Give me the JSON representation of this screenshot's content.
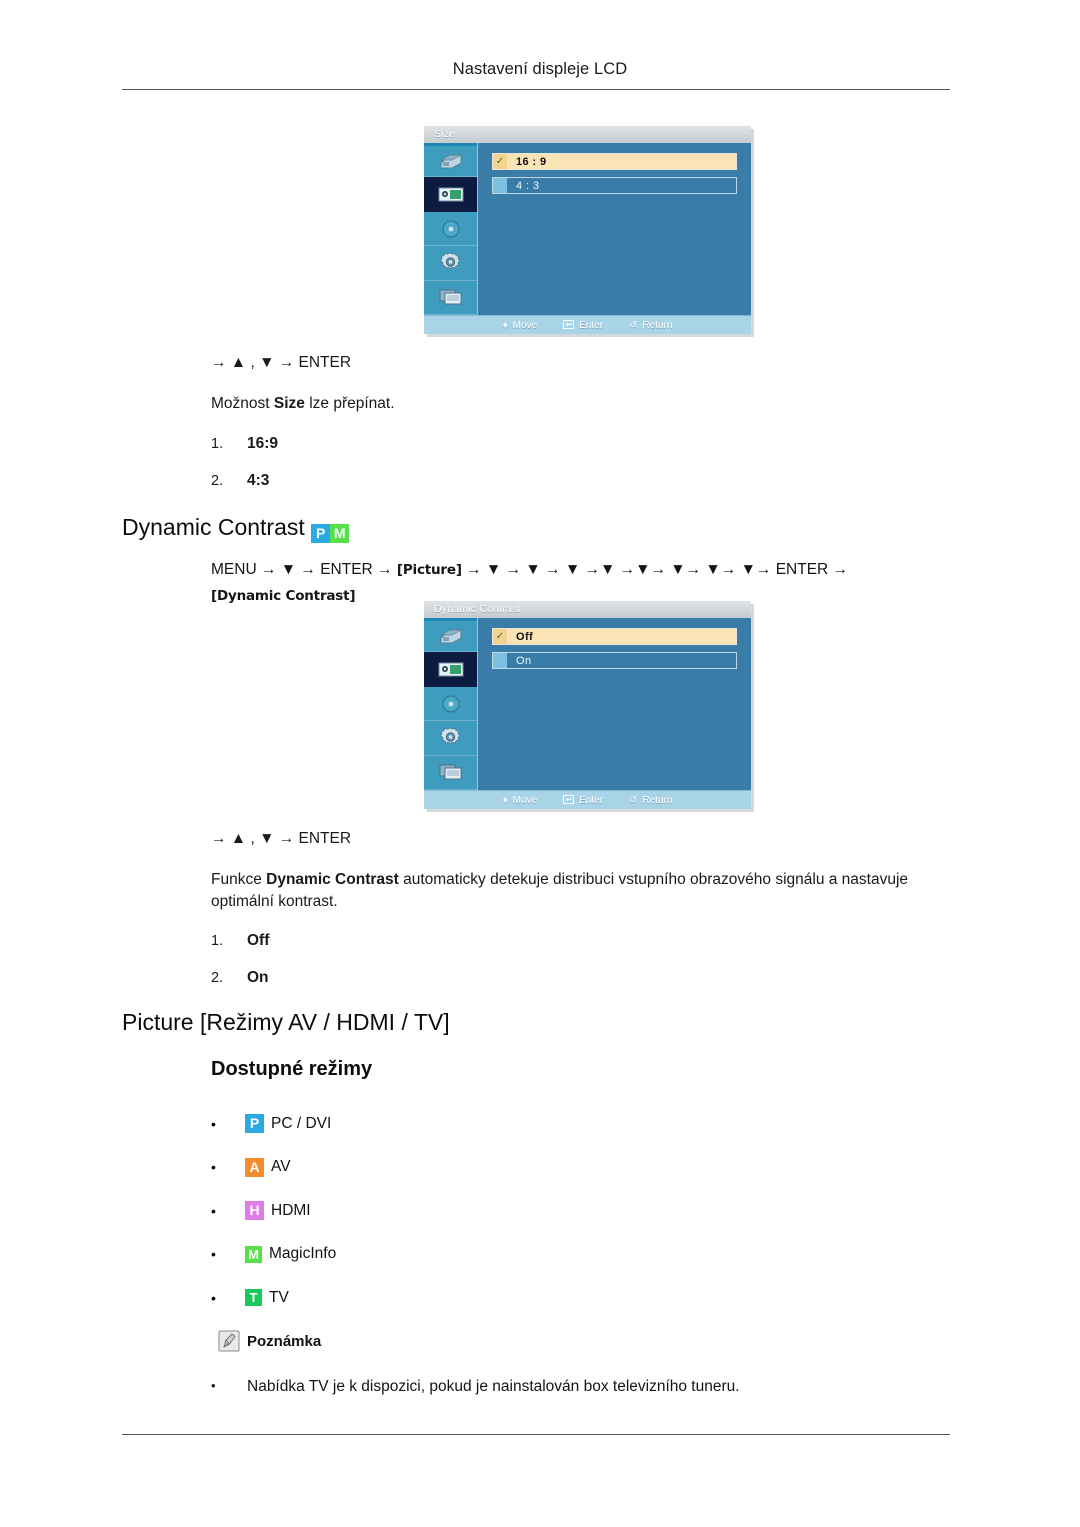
{
  "header": {
    "title": "Nastavení displeje LCD"
  },
  "osd_size": {
    "title": "Size",
    "options": [
      {
        "label": "16 : 9",
        "selected": true
      },
      {
        "label": "4 : 3",
        "selected": false
      }
    ],
    "sidebar_icons": [
      "input-source-icon",
      "picture-icon",
      "sound-icon",
      "setup-gear-icon",
      "multi-control-icon"
    ],
    "active_icon_index": 1,
    "footer": [
      {
        "icon": "move-updown-icon",
        "glyph": "♦",
        "label": "Move"
      },
      {
        "icon": "enter-key-icon",
        "glyph": "↵",
        "label": "Enter"
      },
      {
        "icon": "return-icon",
        "glyph": "↺",
        "label": "Return"
      }
    ]
  },
  "size_section": {
    "keypath": "→ ▲ , ▼ → ENTER",
    "desc_pre": "Možnost ",
    "desc_bold": "Size",
    "desc_post": " lze přepínat.",
    "list": [
      {
        "num": "1.",
        "value": "16:9"
      },
      {
        "num": "2.",
        "value": "4:3"
      }
    ]
  },
  "dynamic_contrast": {
    "heading": "Dynamic Contrast",
    "heading_badges": [
      {
        "letter": "P",
        "color": "#2aaae1",
        "name": "pc-dvi-badge"
      },
      {
        "letter": "M",
        "color": "#56e04a",
        "name": "magicinfo-badge"
      }
    ],
    "navpath": {
      "segments": [
        "MENU",
        "→",
        "▼",
        "→",
        "ENTER",
        "→",
        "[Picture]",
        "→",
        "▼",
        "→",
        "▼",
        "→",
        "▼",
        "→",
        "▼",
        "→",
        "▼",
        "→",
        "▼",
        "→",
        "▼",
        "→",
        "▼",
        "→",
        "ENTER",
        "→"
      ],
      "text_line1": "MENU → ▼ → ENTER →",
      "boxed1": "[Picture]",
      "mid": "→ ▼ → ▼ → ▼ →▼ →▼→ ▼→ ▼→ ▼→ ENTER →",
      "boxed2": "[Dynamic Contrast]"
    },
    "osd": {
      "title": "Dynamic Contrast",
      "options": [
        {
          "label": "Off",
          "selected": true
        },
        {
          "label": "On",
          "selected": false
        }
      ],
      "footer": [
        {
          "icon": "move-updown-icon",
          "glyph": "♦",
          "label": "Move"
        },
        {
          "icon": "enter-key-icon",
          "glyph": "↵",
          "label": "Enter"
        },
        {
          "icon": "return-icon",
          "glyph": "↺",
          "label": "Return"
        }
      ]
    },
    "keypath": "→ ▲ , ▼ → ENTER",
    "desc_pre": "Funkce ",
    "desc_bold": "Dynamic Contrast",
    "desc_post": " automaticky detekuje distribuci vstupního obrazového signálu a nastavuje optimální kontrast.",
    "list": [
      {
        "num": "1.",
        "value": "Off"
      },
      {
        "num": "2.",
        "value": "On"
      }
    ]
  },
  "picture_section": {
    "heading": "Picture [Režimy AV / HDMI / TV]",
    "subheading": "Dostupné režimy",
    "modes": [
      {
        "bullet": "•",
        "badge": "P",
        "color": "#2aaae1",
        "label": "PC / DVI",
        "badge_name": "pc-dvi-badge"
      },
      {
        "bullet": "•",
        "badge": "A",
        "color": "#f58b2c",
        "label": "AV",
        "badge_name": "av-badge"
      },
      {
        "bullet": "•",
        "badge": "H",
        "color": "#e07ce8",
        "label": "HDMI",
        "badge_name": "hdmi-badge"
      },
      {
        "bullet": "•",
        "badge": "M",
        "color": "#56e04a",
        "label": "MagicInfo",
        "badge_name": "magicinfo-badge"
      },
      {
        "bullet": "•",
        "badge": "T",
        "color": "#19c95c",
        "label": "TV",
        "badge_name": "tv-badge"
      }
    ],
    "note_label": "Poznámka",
    "note_bullet": "•",
    "note_text": "Nabídka TV je k dispozici, pokud je nainstalován box televizního tuneru."
  }
}
